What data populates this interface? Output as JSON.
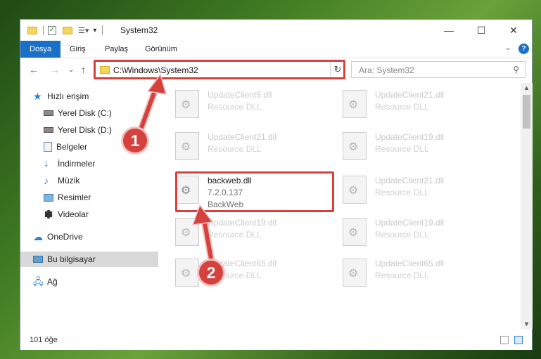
{
  "window": {
    "title": "System32"
  },
  "ribbon": {
    "tabs": [
      "Dosya",
      "Giriş",
      "Paylaş",
      "Görünüm"
    ]
  },
  "address": {
    "path": "C:\\Windows\\System32"
  },
  "search": {
    "placeholder": "Ara: System32"
  },
  "sidebar": {
    "items": [
      {
        "label": "Hızlı erişim",
        "icon": "star-icon"
      },
      {
        "label": "Yerel Disk (C:)",
        "icon": "drive-icon"
      },
      {
        "label": "Yerel Disk (D:)",
        "icon": "drive-icon"
      },
      {
        "label": "Belgeler",
        "icon": "documents-icon"
      },
      {
        "label": "İndirmeler",
        "icon": "download-icon"
      },
      {
        "label": "Müzik",
        "icon": "music-icon"
      },
      {
        "label": "Resimler",
        "icon": "pictures-icon"
      },
      {
        "label": "Videolar",
        "icon": "videos-icon"
      },
      {
        "label": "OneDrive",
        "icon": "cloud-icon"
      },
      {
        "label": "Bu bilgisayar",
        "icon": "computer-icon"
      },
      {
        "label": "Ağ",
        "icon": "network-icon"
      }
    ]
  },
  "files": [
    {
      "name": "UpdateClient5.dll",
      "type": "Resource DLL"
    },
    {
      "name": "UpdateClient21.dll",
      "type": "Resource DLL"
    },
    {
      "name": "UpdateClient21.dll",
      "type": "Resource DLL"
    },
    {
      "name": "UpdateClient19.dll",
      "type": "Resource DLL"
    },
    {
      "name": "backweb.dll",
      "version": "7.2.0.137",
      "company": "BackWeb"
    },
    {
      "name": "UpdateClient21.dll",
      "type": "Resource DLL"
    },
    {
      "name": "UpdateClient19.dll",
      "type": "Resource DLL"
    },
    {
      "name": "UpdateClient19.dll",
      "type": "Resource DLL"
    },
    {
      "name": "UpdateClient65.dll",
      "type": "Resource DLL"
    },
    {
      "name": "UpdateClient65.dll",
      "type": "Resource DLL"
    }
  ],
  "status": {
    "count": "101 öğe"
  },
  "annotations": {
    "step1": "1",
    "step2": "2"
  },
  "colors": {
    "accent": "#1a6fc8",
    "highlight": "#d9403d"
  }
}
